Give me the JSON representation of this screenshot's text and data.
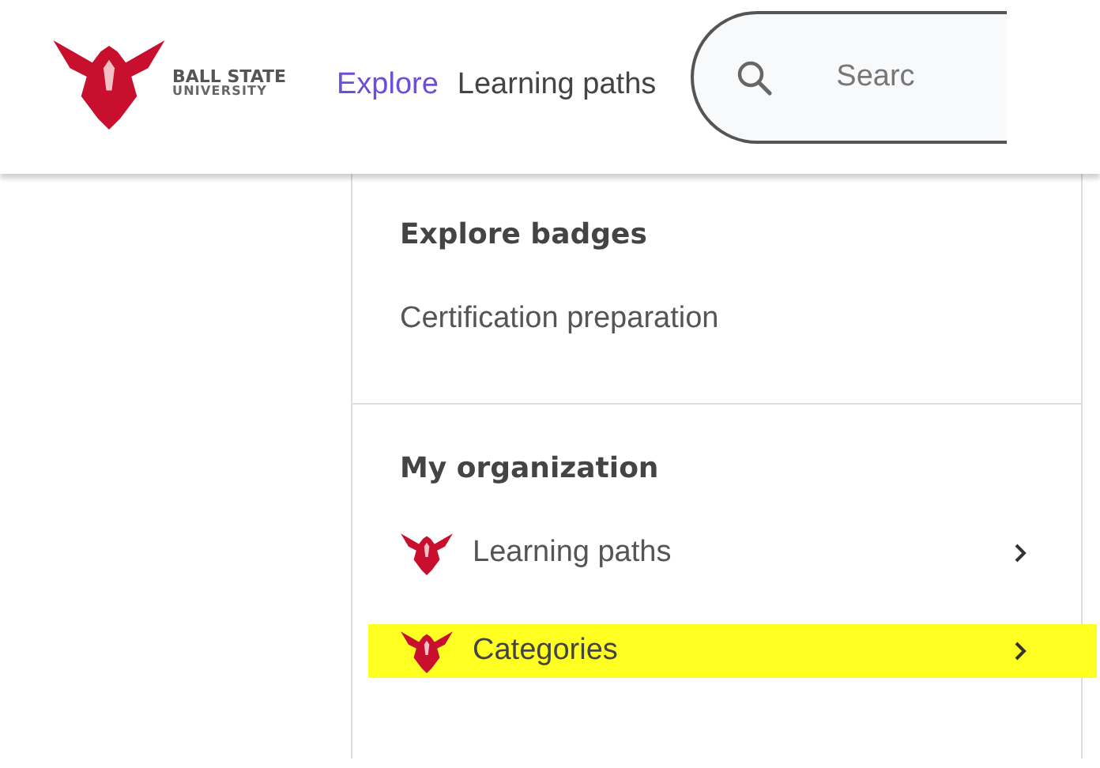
{
  "header": {
    "brand": {
      "line_1": "BALL STATE",
      "line_2": "UNIVERSITY"
    },
    "nav": [
      {
        "label": "Explore",
        "selected": true
      },
      {
        "label": "Learning paths",
        "selected": false
      }
    ],
    "search": {
      "placeholder": "Searc"
    }
  },
  "menu": {
    "sections": [
      {
        "heading": "Explore badges",
        "items": [
          {
            "label": "Certification preparation",
            "kind": "plain",
            "highlighted": false
          }
        ]
      },
      {
        "heading": "My organization",
        "items": [
          {
            "label": "Learning paths",
            "kind": "org",
            "highlighted": false
          },
          {
            "label": "Categories",
            "kind": "org",
            "highlighted": true
          }
        ]
      }
    ]
  }
}
